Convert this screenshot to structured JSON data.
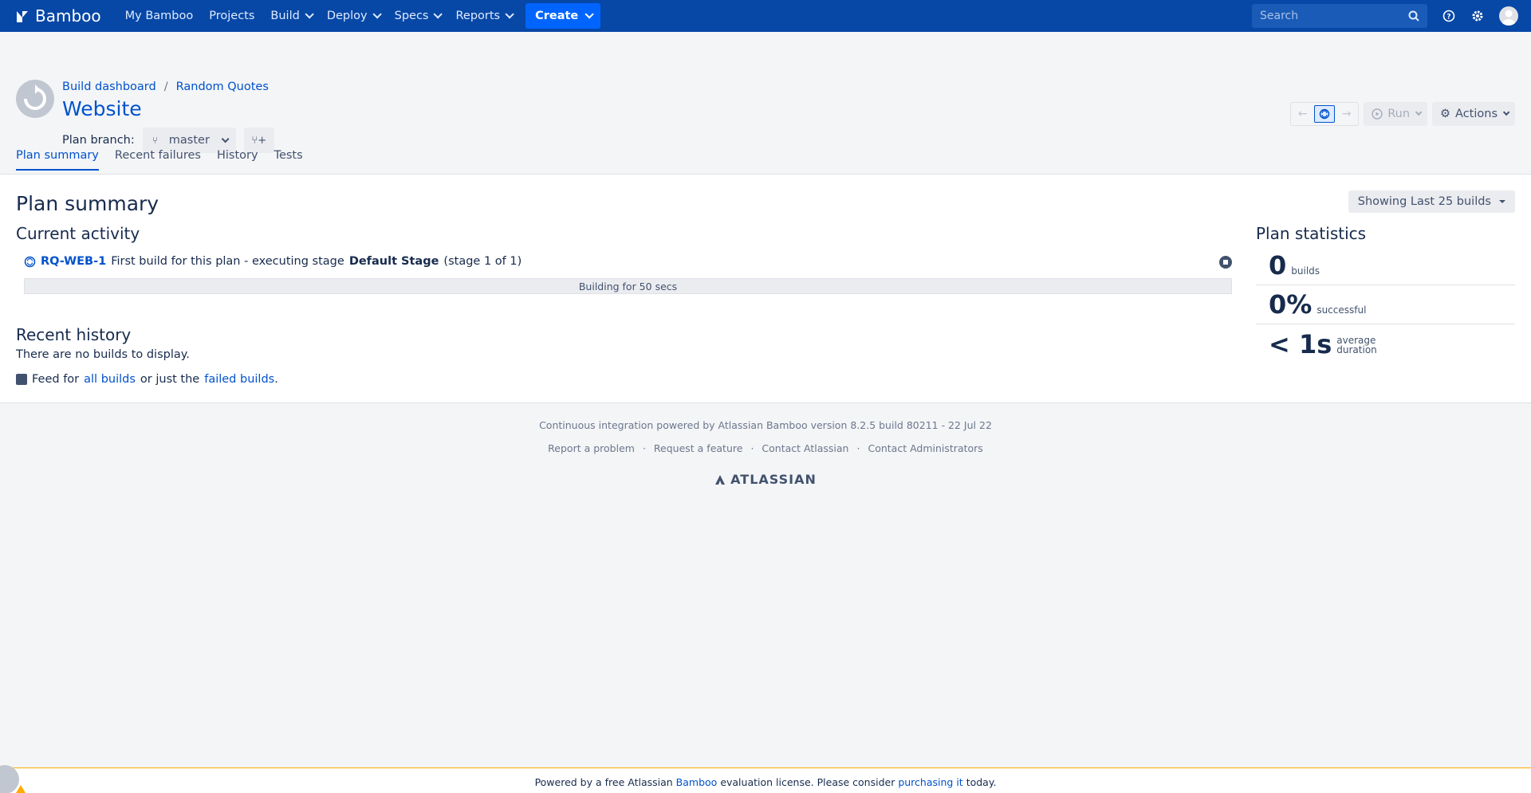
{
  "topnav": {
    "logo_text": "Bamboo",
    "items": [
      {
        "label": "My Bamboo",
        "has_menu": false
      },
      {
        "label": "Projects",
        "has_menu": false
      },
      {
        "label": "Build",
        "has_menu": true
      },
      {
        "label": "Deploy",
        "has_menu": true
      },
      {
        "label": "Specs",
        "has_menu": true
      },
      {
        "label": "Reports",
        "has_menu": true
      }
    ],
    "create_label": "Create",
    "search_placeholder": "Search",
    "icons": [
      "help-icon",
      "settings-icon",
      "avatar"
    ]
  },
  "header": {
    "breadcrumb": [
      "Build dashboard",
      "Random Quotes"
    ],
    "title": "Website",
    "branch_label": "Plan branch:",
    "branch_value": "master",
    "run_label": "Run",
    "actions_label": "Actions"
  },
  "tabs": [
    {
      "label": "Plan summary",
      "active": true
    },
    {
      "label": "Recent failures",
      "active": false
    },
    {
      "label": "History",
      "active": false
    },
    {
      "label": "Tests",
      "active": false
    }
  ],
  "main": {
    "title": "Plan summary",
    "showing_label": "Showing Last 25 builds",
    "current_activity_title": "Current activity",
    "activity": {
      "key": "RQ-WEB-1",
      "text_before": "First build for this plan - executing stage",
      "stage": "Default Stage",
      "text_after": "(stage 1 of 1)",
      "progress_text": "Building for 50 secs"
    },
    "recent_history_title": "Recent history",
    "no_builds_text": "There are no builds to display.",
    "feed": {
      "prefix": "Feed for",
      "all_link": "all builds",
      "middle": "or just the",
      "failed_link": "failed builds",
      "suffix": "."
    }
  },
  "stats": {
    "title": "Plan statistics",
    "items": [
      {
        "value": "0",
        "label": "builds"
      },
      {
        "value": "0%",
        "label": "successful"
      },
      {
        "value": "< 1s",
        "label": "average duration"
      }
    ]
  },
  "footer": {
    "powered": "Continuous integration powered by Atlassian Bamboo version 8.2.5 build 80211 - 22 Jul 22",
    "links": [
      "Report a problem",
      "Request a feature",
      "Contact Atlassian",
      "Contact Administrators"
    ],
    "brand": "ATLASSIAN"
  },
  "license": {
    "prefix": "Powered by a free Atlassian",
    "bamboo_link": "Bamboo",
    "middle": "evaluation license. Please consider",
    "purchase_link": "purchasing it",
    "suffix": "today."
  },
  "colors": {
    "nav_bg": "#0747a6",
    "accent": "#0052cc",
    "create": "#0065ff",
    "warning": "#ffab00"
  }
}
